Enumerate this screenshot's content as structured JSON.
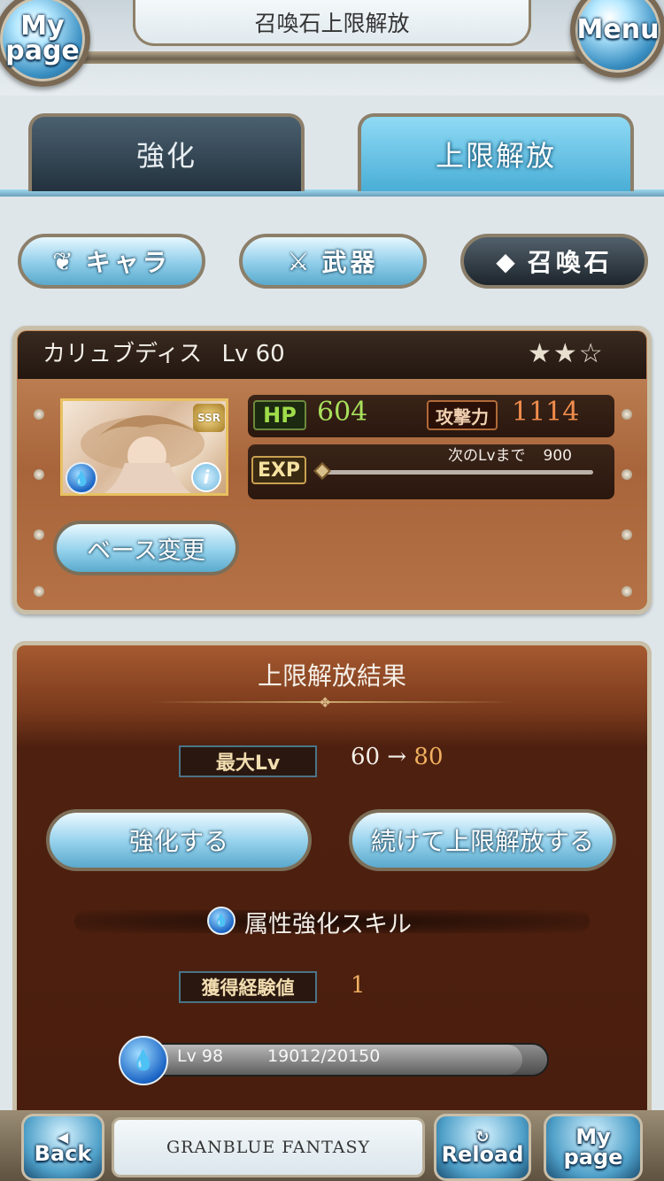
{
  "header": {
    "title": "召喚石上限解放",
    "mypage_top": "My",
    "mypage_bottom": "page",
    "menu": "Menu"
  },
  "tabs": [
    {
      "label": "強化",
      "active": false
    },
    {
      "label": "上限解放",
      "active": true
    }
  ],
  "categories": [
    {
      "label": "キャラ",
      "icon": "character-emblem-icon",
      "active": false
    },
    {
      "label": "武器",
      "icon": "crossed-swords-icon",
      "active": false
    },
    {
      "label": "召喚石",
      "icon": "crystal-icon",
      "active": true
    }
  ],
  "summon": {
    "name": "カリュブディス",
    "level_text": "Lv 60",
    "stars": "★★☆",
    "rarity": "SSR",
    "element_icon": "water-element-icon",
    "hp_label": "HP",
    "hp": "604",
    "atk_label": "攻撃力",
    "atk": "1114",
    "exp_label": "EXP",
    "next_label": "次のLvまで",
    "next_value": "900",
    "base_button": "ベース変更"
  },
  "result": {
    "title": "上限解放結果",
    "max_lv_label": "最大Lv",
    "max_lv_from": "60",
    "arrow": "→",
    "max_lv_to": "80",
    "enhance_button": "強化する",
    "continue_button": "続けて上限解放する",
    "skill_name": "属性強化スキル",
    "exp_gain_label": "獲得経験値",
    "exp_gain_value": "1",
    "player_level": "Lv 98",
    "player_exp": "19012/20150",
    "player_exp_progress": 0.94
  },
  "footer": {
    "back_arrow": "◀",
    "back": "Back",
    "logo": "GRANBLUE FANTASY",
    "reload_icon": "↻",
    "reload": "Reload",
    "mypage_top": "My",
    "mypage_bottom": "page"
  },
  "colors": {
    "accent_blue": "#5aa9cd",
    "panel_brown": "#a8643a",
    "hp_green": "#a8e05c",
    "atk_orange": "#f08c4c"
  }
}
